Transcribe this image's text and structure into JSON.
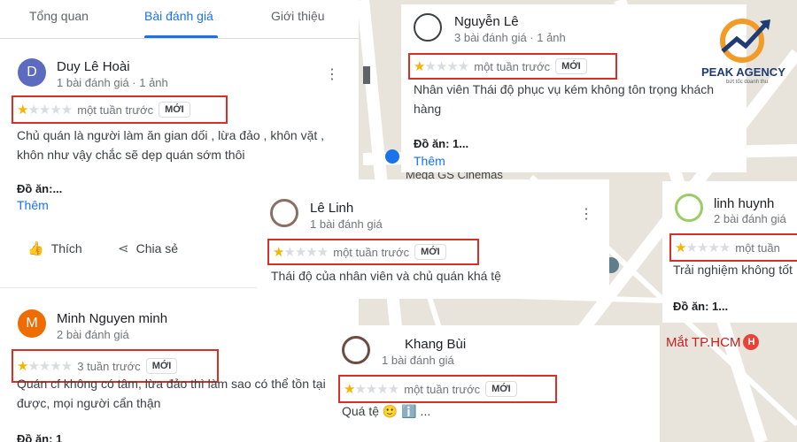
{
  "tabs": [
    {
      "label": "Tổng quan"
    },
    {
      "label": "Bài đánh giá"
    },
    {
      "label": "Giới thiệu"
    }
  ],
  "map_labels": {
    "cinema": "Mega GS Cinemas",
    "hospital": "Mắt TP.HCM",
    "hospital_marker": "H"
  },
  "logo": {
    "text": "PEAK AGENCY",
    "tagline": "bứt tốc doanh thu"
  },
  "reviews": {
    "duy": {
      "avatar_letter": "D",
      "avatar_color": "#5c6bc0",
      "name": "Duy Lê Hoài",
      "meta": "1 bài đánh giá · 1 ảnh",
      "time": "một tuần trước",
      "badge": "MỚI",
      "text": "Chủ quán là người làm ăn gian dối , lừa đảo , khôn vặt , khôn như vậy chắc sẽ dẹp quán sớm thôi",
      "dish": "Đồ ăn:...",
      "more": "Thêm",
      "like": "Thích",
      "share": "Chia sẻ",
      "rating": 1
    },
    "minh": {
      "avatar_letter": "M",
      "avatar_color": "#ef6c00",
      "name": "Minh Nguyen minh",
      "meta": "2 bài đánh giá",
      "time": "3 tuần trước",
      "badge": "MỚI",
      "text": "Quán cf không có tâm, lừa đảo thì làm sao có thể tồn tại được, mọi người cẩn thận",
      "dish": "Đồ ăn: 1",
      "rating": 1
    },
    "nguyen": {
      "name": "Nguyễn Lê",
      "meta": "3 bài đánh giá · 1 ảnh",
      "time": "một tuần trước",
      "badge": "MỚI",
      "text": "Nhân viên Thái độ phục vụ kém không tôn trọng khách hàng",
      "dish": "Đồ ăn: 1...",
      "more": "Thêm",
      "rating": 1
    },
    "linh": {
      "name": "Lê Linh",
      "meta": "1 bài đánh giá",
      "time": "một tuần trước",
      "badge": "MỚI",
      "text": "Thái độ của nhân viên và chủ quán khá tệ",
      "rating": 1
    },
    "huynh": {
      "name": "linh huynh",
      "meta": "2 bài đánh giá",
      "time": "một tuần",
      "text": "Trải nghiệm không tốt",
      "dish": "Đồ ăn: 1...",
      "rating": 1
    },
    "khang": {
      "name": "Khang Bùi",
      "meta": "1 bài đánh giá",
      "time": "một tuần trước",
      "badge": "MỚI",
      "text": "Quá tệ 🙂 ℹ️ ...",
      "rating": 1
    }
  },
  "colors": {
    "accent": "#1a73e8",
    "highlight": "#d93025",
    "star": "#f4b400"
  }
}
